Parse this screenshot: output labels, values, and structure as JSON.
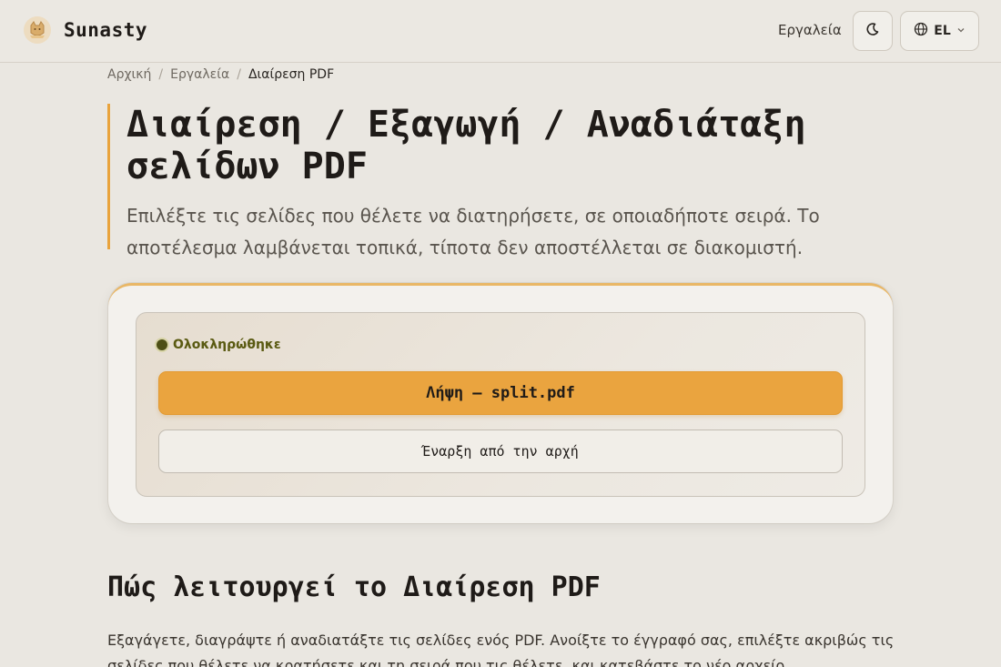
{
  "header": {
    "brand": "Sunasty",
    "nav_tools": "Εργαλεία",
    "language": "EL"
  },
  "breadcrumb": {
    "home": "Αρχική",
    "tools": "Εργαλεία",
    "current": "Διαίρεση PDF"
  },
  "hero": {
    "title": "Διαίρεση / Εξαγωγή / Αναδιάταξη σελίδων PDF",
    "subtitle": "Επιλέξτε τις σελίδες που θέλετε να διατηρήσετε, σε οποιαδήποτε σειρά. Το αποτέλεσμα λαμβάνεται τοπικά, τίποτα δεν αποστέλλεται σε διακομιστή."
  },
  "result": {
    "status": "Ολοκληρώθηκε",
    "download_label": "Λήψη — split.pdf",
    "restart_label": "Έναρξη από την αρχή"
  },
  "how": {
    "title": "Πώς λειτουργεί το Διαίρεση PDF",
    "text": "Εξαγάγετε, διαγράψτε ή αναδιατάξτε τις σελίδες ενός PDF. Ανοίξτε το έγγραφό σας, επιλέξτε ακριβώς τις σελίδες που θέλετε να κρατήσετε και τη σειρά που τις θέλετε, και κατεβάστε το νέο αρχείο."
  },
  "colors": {
    "accent": "#eaa43f",
    "success": "#4d4f16",
    "background": "#eae7e1"
  }
}
